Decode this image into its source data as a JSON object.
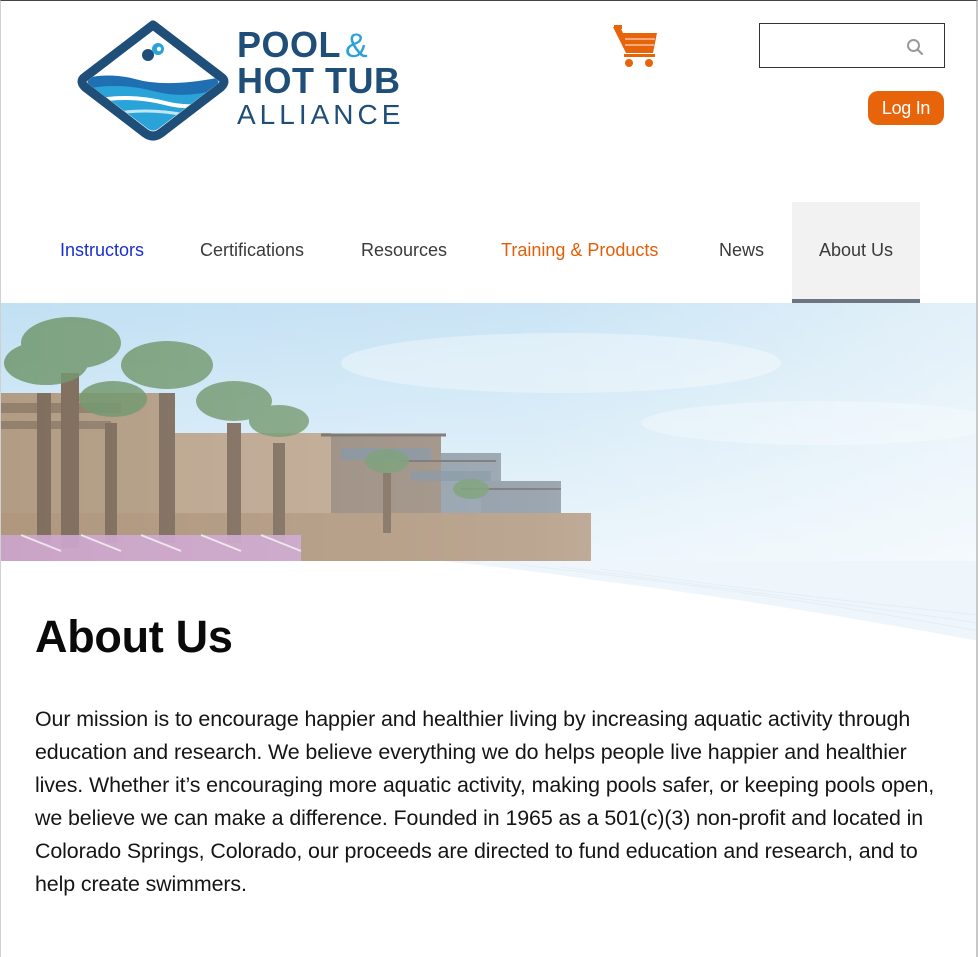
{
  "header": {
    "logo": {
      "line1": "POOL",
      "ampersand": "&",
      "line2": "HOT TUB",
      "line3": "ALLIANCE"
    },
    "cart_icon": "shopping-cart-icon",
    "search": {
      "placeholder": "",
      "icon": "search-icon"
    },
    "login_label": "Log In"
  },
  "nav": {
    "items": [
      {
        "label": "Instructors"
      },
      {
        "label": "Certifications"
      },
      {
        "label": "Resources"
      },
      {
        "label": "Training & Products"
      },
      {
        "label": "News"
      },
      {
        "label": "About Us"
      }
    ]
  },
  "main": {
    "title": "About Us",
    "body": "Our mission is to encourage happier and healthier living by increasing aquatic activity through education and research. We believe everything we do helps people live happier and healthier lives. Whether it’s encouraging more aquatic activity, making pools safer, or keeping pools open, we believe we can make a difference. Founded in 1965 as a 501(c)(3) non-profit and located in Colorado Springs, Colorado, our proceeds are directed to fund education and research, and to help create swimmers."
  },
  "colors": {
    "accent_orange": "#e8640a",
    "brand_navy": "#1f4e79",
    "brand_blue": "#2aa3d9",
    "nav_link_blue": "#1a2fd0"
  }
}
